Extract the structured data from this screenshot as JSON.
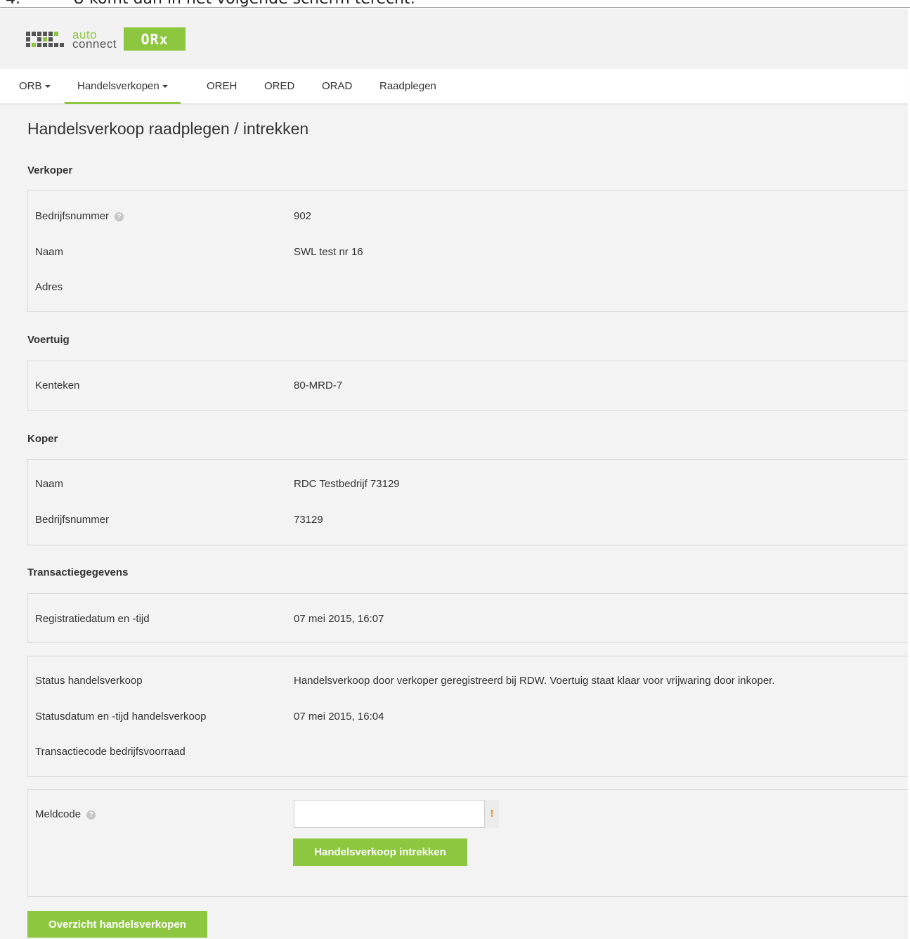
{
  "doc": {
    "step_number": "4.",
    "step_text": "U komt dan in het volgende scherm terecht:"
  },
  "brand": {
    "word1": "auto",
    "word2": "connect",
    "badge": "ORx",
    "accent_color": "#8dc63f"
  },
  "nav": {
    "items": [
      {
        "label": "ORB",
        "dropdown": true
      },
      {
        "label": "Handelsverkopen",
        "dropdown": true,
        "active": true
      },
      {
        "label": "OREH"
      },
      {
        "label": "ORED"
      },
      {
        "label": "ORAD"
      },
      {
        "label": "Raadplegen"
      }
    ]
  },
  "page": {
    "title": "Handelsverkoop raadplegen / intrekken"
  },
  "verkoper": {
    "title": "Verkoper",
    "bedrijfsnummer_label": "Bedrijfsnummer",
    "bedrijfsnummer_value": "902",
    "naam_label": "Naam",
    "naam_value": "SWL test nr 16",
    "adres_label": "Adres",
    "adres_value": ""
  },
  "voertuig": {
    "title": "Voertuig",
    "kenteken_label": "Kenteken",
    "kenteken_value": "80-MRD-7"
  },
  "koper": {
    "title": "Koper",
    "naam_label": "Naam",
    "naam_value": "RDC Testbedrijf 73129",
    "bedrijfsnummer_label": "Bedrijfsnummer",
    "bedrijfsnummer_value": "73129"
  },
  "transactie": {
    "title": "Transactiegegevens",
    "registratie_label": "Registratiedatum en -tijd",
    "registratie_value": "07 mei 2015, 16:07",
    "status_label": "Status handelsverkoop",
    "status_value": "Handelsverkoop door verkoper geregistreerd bij RDW. Voertuig staat klaar voor vrijwaring door inkoper.",
    "statusdatum_label": "Statusdatum en -tijd handelsverkoop",
    "statusdatum_value": "07 mei 2015, 16:04",
    "transactiecode_label": "Transactiecode bedrijfsvoorraad",
    "transactiecode_value": ""
  },
  "meldcode": {
    "label": "Meldcode",
    "value": "",
    "warning": "!",
    "submit_label": "Handelsverkoop intrekken"
  },
  "footer": {
    "overview_label": "Overzicht handelsverkopen"
  },
  "icons": {
    "help": "?"
  }
}
